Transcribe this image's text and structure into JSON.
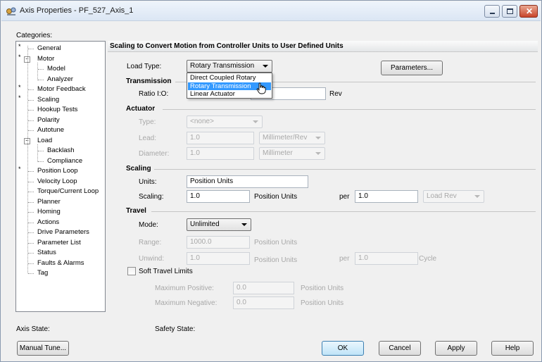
{
  "window": {
    "title": "Axis Properties - PF_527_Axis_1"
  },
  "categories": {
    "label": "Categories:",
    "items": [
      {
        "label": "General",
        "starred": true
      },
      {
        "label": "Motor",
        "starred": true
      },
      {
        "label": "Model",
        "starred": false
      },
      {
        "label": "Analyzer",
        "starred": false
      },
      {
        "label": "Motor Feedback",
        "starred": true
      },
      {
        "label": "Scaling",
        "starred": true
      },
      {
        "label": "Hookup Tests",
        "starred": false
      },
      {
        "label": "Polarity",
        "starred": false
      },
      {
        "label": "Autotune",
        "starred": false
      },
      {
        "label": "Load",
        "starred": false
      },
      {
        "label": "Backlash",
        "starred": false
      },
      {
        "label": "Compliance",
        "starred": false
      },
      {
        "label": "Position Loop",
        "starred": true
      },
      {
        "label": "Velocity Loop",
        "starred": false
      },
      {
        "label": "Torque/Current Loop",
        "starred": false
      },
      {
        "label": "Planner",
        "starred": false
      },
      {
        "label": "Homing",
        "starred": false
      },
      {
        "label": "Actions",
        "starred": false
      },
      {
        "label": "Drive Parameters",
        "starred": false
      },
      {
        "label": "Parameter List",
        "starred": false
      },
      {
        "label": "Status",
        "starred": false
      },
      {
        "label": "Faults & Alarms",
        "starred": false
      },
      {
        "label": "Tag",
        "starred": false
      }
    ],
    "star": "*",
    "expander_minus": "−"
  },
  "page": {
    "heading": "Scaling to Convert Motion from Controller Units to User Defined Units",
    "load_type_label": "Load Type:",
    "load_type_value": "Rotary Transmission",
    "parameters_button": "Parameters...",
    "load_type_options": [
      "Direct Coupled Rotary",
      "Rotary Transmission",
      "Linear Actuator"
    ],
    "transmission": {
      "header": "Transmission",
      "ratio_label": "Ratio I:O:",
      "ratio_unit": "Rev"
    },
    "actuator": {
      "header": "Actuator",
      "type_label": "Type:",
      "type_value": "<none>",
      "lead_label": "Lead:",
      "lead_value": "1.0",
      "lead_unit": "Millimeter/Rev",
      "diameter_label": "Diameter:",
      "diameter_value": "1.0",
      "diameter_unit": "Millimeter"
    },
    "scaling": {
      "header": "Scaling",
      "units_label": "Units:",
      "units_value": "Position Units",
      "scaling_label": "Scaling:",
      "scaling_value": "1.0",
      "scaling_unit": "Position Units",
      "per_label": "per",
      "per_value": "1.0",
      "per_unit": "Load Rev"
    },
    "travel": {
      "header": "Travel",
      "mode_label": "Mode:",
      "mode_value": "Unlimited",
      "range_label": "Range:",
      "range_value": "1000.0",
      "range_unit": "Position Units",
      "unwind_label": "Unwind:",
      "unwind_value": "1.0",
      "unwind_unit": "Position Units",
      "unwind_per_label": "per",
      "unwind_per_value": "1.0",
      "unwind_per_unit": "Cycle",
      "soft_limits_label": "Soft Travel Limits",
      "max_pos_label": "Maximum Positive:",
      "max_pos_value": "0.0",
      "max_pos_unit": "Position Units",
      "max_neg_label": "Maximum Negative:",
      "max_neg_value": "0.0",
      "max_neg_unit": "Position Units"
    }
  },
  "status": {
    "axis_state_label": "Axis State:",
    "safety_state_label": "Safety State:"
  },
  "buttons": {
    "manual_tune": "Manual Tune...",
    "ok": "OK",
    "cancel": "Cancel",
    "apply": "Apply",
    "help": "Help"
  }
}
